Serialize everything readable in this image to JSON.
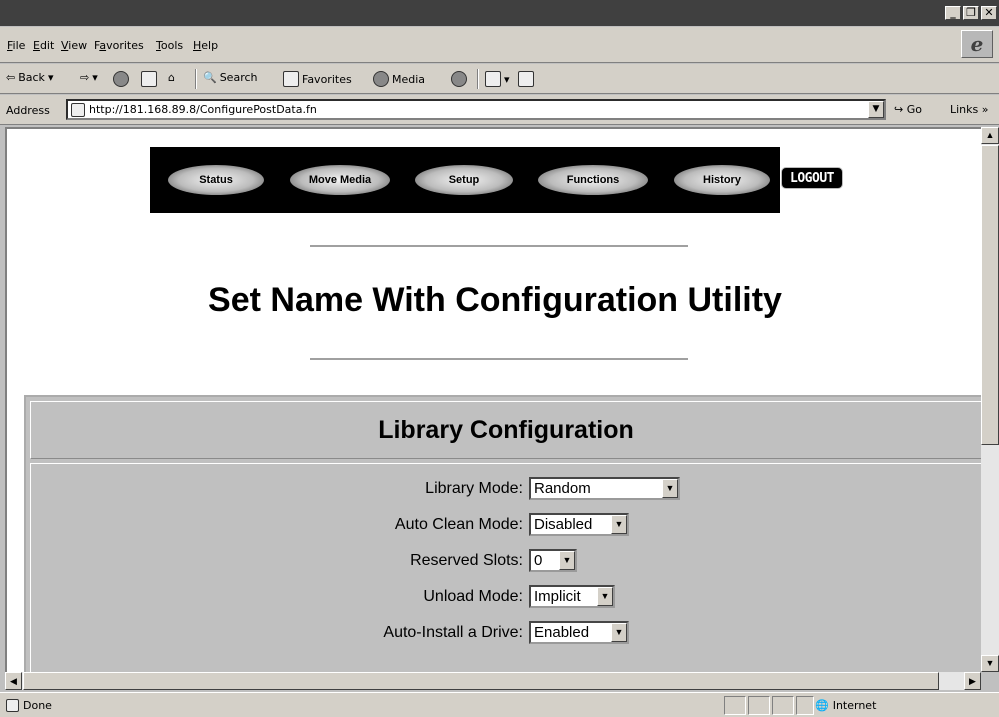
{
  "window": {
    "buttons": [
      "_",
      "❐",
      "✕"
    ]
  },
  "menu": {
    "items": [
      {
        "key": "F",
        "rest": "ile"
      },
      {
        "key": "E",
        "rest": "dit"
      },
      {
        "key": "V",
        "rest": "iew"
      },
      {
        "pre": "F",
        "key": "a",
        "rest": "vorites"
      },
      {
        "key": "T",
        "rest": "ools"
      },
      {
        "key": "H",
        "rest": "elp"
      }
    ]
  },
  "toolbar": {
    "back": "Back",
    "search": "Search",
    "favorites": "Favorites",
    "media": "Media"
  },
  "address": {
    "label": "Address",
    "url": "http://181.168.89.8/ConfigurePostData.fn",
    "go": "Go",
    "links": "Links"
  },
  "nav": {
    "status": "Status",
    "move_media": "Move Media",
    "setup": "Setup",
    "functions": "Functions",
    "history": "History",
    "logout": "LOGOUT"
  },
  "page": {
    "title": "Set Name With Configuration Utility"
  },
  "config": {
    "header": "Library Configuration",
    "rows": [
      {
        "label": "Library Mode:",
        "value": "Random"
      },
      {
        "label": "Auto Clean Mode:",
        "value": "Disabled"
      },
      {
        "label": "Reserved Slots:",
        "value": "0"
      },
      {
        "label": "Unload Mode:",
        "value": "Implicit"
      },
      {
        "label": "Auto-Install a Drive:",
        "value": "Enabled"
      }
    ]
  },
  "status": {
    "text": "Done",
    "zone": "Internet"
  }
}
